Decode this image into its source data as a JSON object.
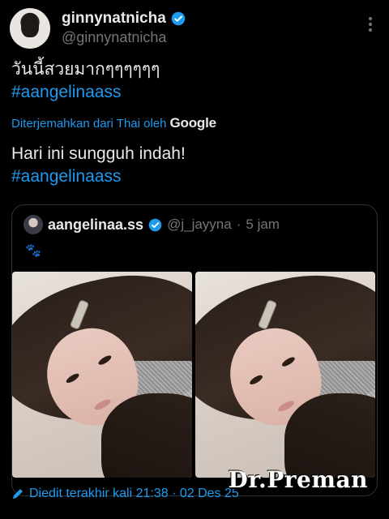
{
  "author": {
    "display_name": "ginnynatnicha",
    "handle": "@ginnynatnicha",
    "verified_icon": "verified-badge-icon",
    "avatar": "profile-photo"
  },
  "tweet": {
    "thai_text": "วันนี้สวยมากๆๆๆๆๆๆ",
    "hashtag": "#aangelinaass",
    "translation_label": "Diterjemahkan dari Thai oleh",
    "translation_provider": "Google",
    "translated_text": "Hari ini sungguh indah!",
    "translated_hashtag": "#aangelinaass"
  },
  "quote": {
    "display_name": "aangelinaa.ss",
    "handle": "@j_jayyna",
    "separator": "·",
    "time": "5 jam",
    "emoji_text": "🐾",
    "media": [
      "photo-1",
      "photo-2"
    ]
  },
  "footer": {
    "edited_text": "Diedit terakhir kali 21:38 · 02 Des 25",
    "watermark": "Dr.Preman"
  },
  "colors": {
    "background": "#000000",
    "accent": "#1d9bf0",
    "text_primary": "#e7e9ea",
    "text_secondary": "#71767b",
    "border": "#2f3336"
  }
}
